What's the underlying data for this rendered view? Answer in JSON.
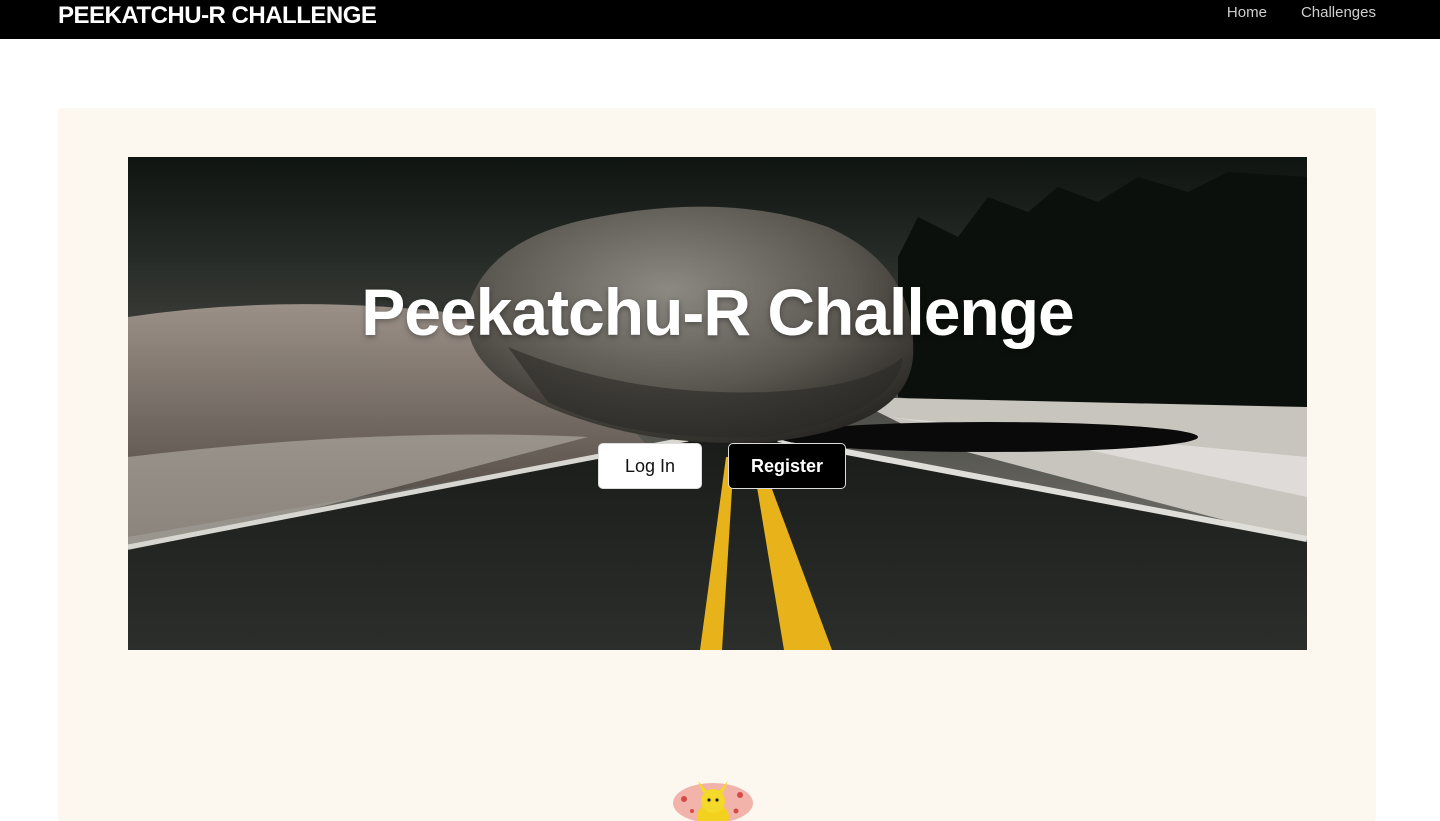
{
  "header": {
    "brand": "PEEKATCHU-R CHALLENGE",
    "nav": [
      {
        "label": "Home"
      },
      {
        "label": "Challenges"
      }
    ]
  },
  "hero": {
    "title": "Peekatchu-R Challenge",
    "login_label": "Log In",
    "register_label": "Register"
  },
  "colors": {
    "topbar": "#000000",
    "panel": "#fdf8ef",
    "road_line": "#e8b21a"
  }
}
